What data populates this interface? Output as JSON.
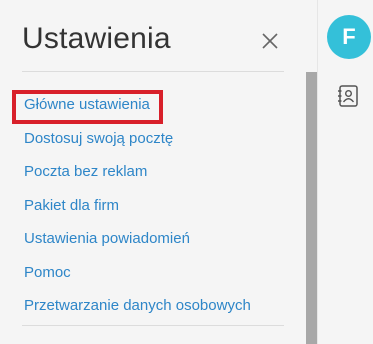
{
  "panel": {
    "title": "Ustawienia",
    "close_icon": "close-icon"
  },
  "menu": {
    "items": [
      {
        "label": "Główne ustawienia"
      },
      {
        "label": "Dostosuj swoją pocztę"
      },
      {
        "label": "Poczta bez reklam"
      },
      {
        "label": "Pakiet dla firm"
      },
      {
        "label": "Ustawienia powiadomień"
      },
      {
        "label": "Pomoc"
      },
      {
        "label": "Przetwarzanie danych osobowych"
      }
    ],
    "highlighted_index": 0
  },
  "right_bar": {
    "avatar_letter": "F",
    "contacts_icon": "contacts-icon"
  },
  "colors": {
    "link": "#2e86c8",
    "highlight": "#d8202a",
    "avatar_bg": "#34c0d9",
    "title": "#333333"
  }
}
